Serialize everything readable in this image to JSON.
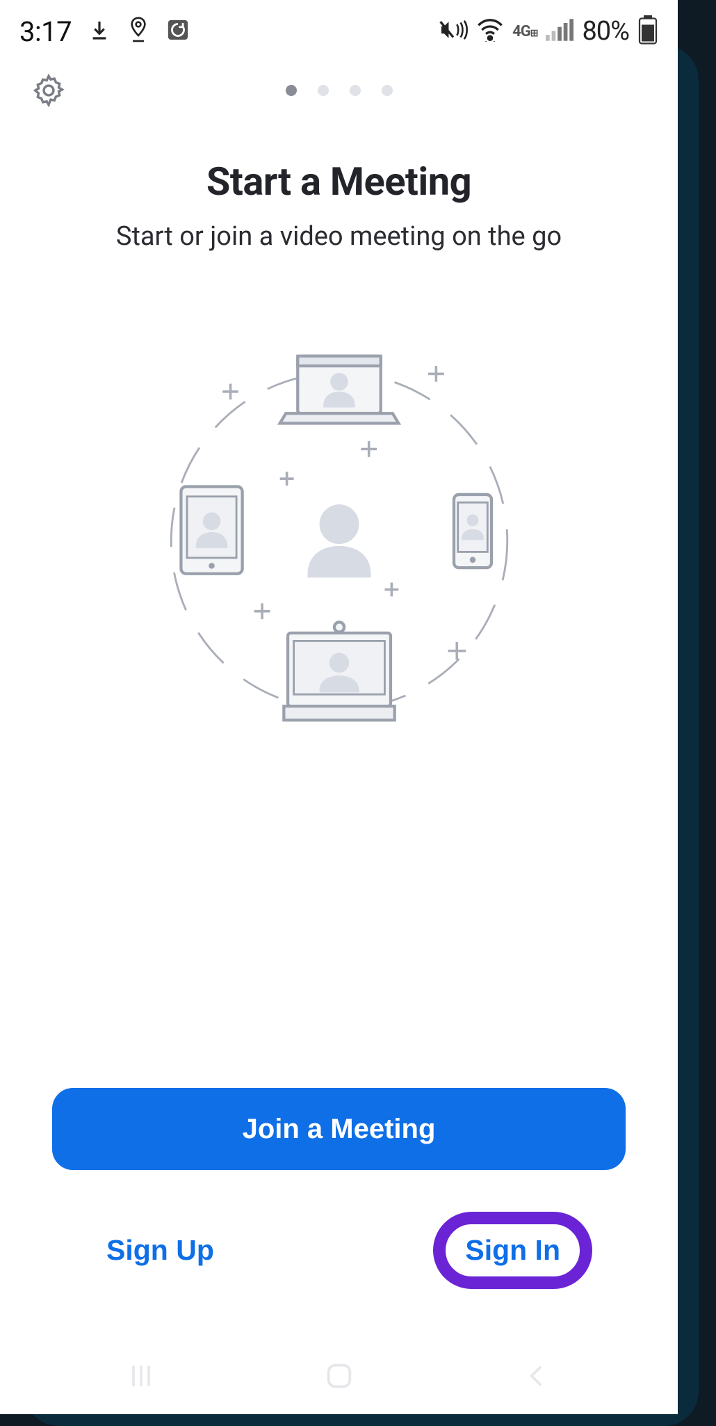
{
  "status_bar": {
    "time": "3:17",
    "battery_text": "80%",
    "network_label": "4G",
    "icons": {
      "download": "download-icon",
      "location": "location-pin-icon",
      "sync": "sync-badge-icon",
      "mute": "mute-vibrate-icon",
      "wifi": "wifi-icon",
      "signal": "cell-signal-icon",
      "battery": "battery-icon"
    }
  },
  "header": {
    "settings_label": "Settings",
    "page_indicator": {
      "count": 4,
      "active_index": 0
    }
  },
  "hero": {
    "title": "Start a Meeting",
    "subtitle": "Start or join a video meeting on the go"
  },
  "actions": {
    "join_label": "Join a Meeting",
    "sign_up_label": "Sign Up",
    "sign_in_label": "Sign In"
  },
  "navigation": {
    "recent": "recent-apps",
    "home": "home",
    "back": "back"
  },
  "colors": {
    "primary": "#0e6fe7",
    "highlight_ring": "#6a24d6",
    "title": "#23242a",
    "subtitle": "#2b2c32",
    "illustration_stroke": "#9aa1ac",
    "illustration_fill": "#d7dbe3"
  }
}
